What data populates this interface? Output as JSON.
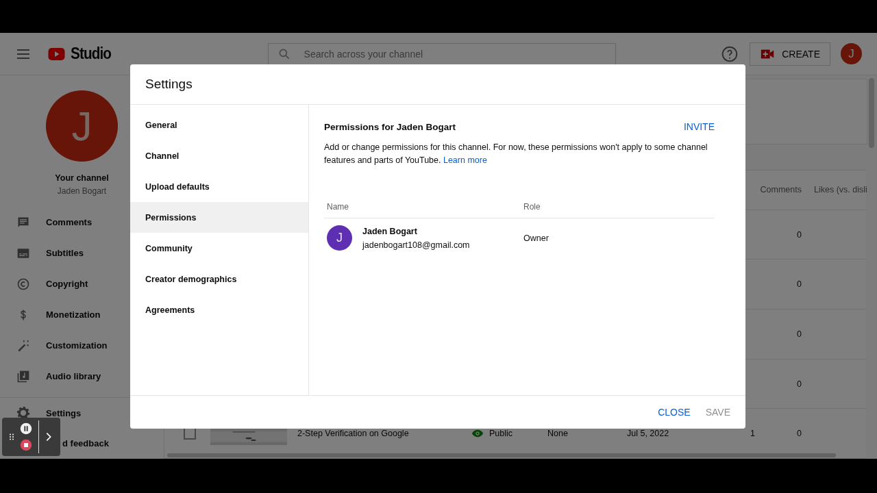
{
  "header": {
    "logo_text": "Studio",
    "search_placeholder": "Search across your channel",
    "create_label": "CREATE",
    "avatar_letter": "J"
  },
  "sidebar": {
    "avatar_letter": "J",
    "channel_label": "Your channel",
    "channel_name": "Jaden Bogart",
    "items": [
      {
        "label": "Comments",
        "kind": "comments"
      },
      {
        "label": "Subtitles",
        "kind": "subtitles"
      },
      {
        "label": "Copyright",
        "kind": "copyright"
      },
      {
        "label": "Monetization",
        "kind": "monetization"
      },
      {
        "label": "Customization",
        "kind": "customization"
      },
      {
        "label": "Audio library",
        "kind": "audio"
      },
      {
        "label": "Settings",
        "kind": "settings"
      },
      {
        "label": "d feedback",
        "kind": "none"
      }
    ]
  },
  "table": {
    "columns": [
      "Comments",
      "Likes (vs. disli"
    ],
    "rows": [
      {
        "comments": "0"
      },
      {
        "comments": "0"
      },
      {
        "comments": "0"
      },
      {
        "comments": "0"
      },
      {
        "checked": false,
        "title": "2-Step Verification on Google",
        "visibility": "Public",
        "restrictions": "None",
        "date": "Jul 5, 2022",
        "views": "1",
        "comments": "0"
      }
    ]
  },
  "dialog": {
    "title": "Settings",
    "nav": [
      {
        "label": "General",
        "selected": false
      },
      {
        "label": "Channel",
        "selected": false
      },
      {
        "label": "Upload defaults",
        "selected": false
      },
      {
        "label": "Permissions",
        "selected": true
      },
      {
        "label": "Community",
        "selected": false
      },
      {
        "label": "Creator demographics",
        "selected": false
      },
      {
        "label": "Agreements",
        "selected": false
      }
    ],
    "section_title": "Permissions for Jaden Bogart",
    "invite_label": "INVITE",
    "description": "Add or change permissions for this channel. For now, these permissions won't apply to some channel features and parts of YouTube.",
    "learn_more": "Learn more",
    "columns": [
      "Name",
      "Role"
    ],
    "members": [
      {
        "initial": "J",
        "name": "Jaden Bogart",
        "email": "jadenbogart108@gmail.com",
        "role": "Owner"
      }
    ],
    "buttons": [
      {
        "label": "CLOSE",
        "disabled": false
      },
      {
        "label": "SAVE",
        "disabled": true
      }
    ]
  }
}
